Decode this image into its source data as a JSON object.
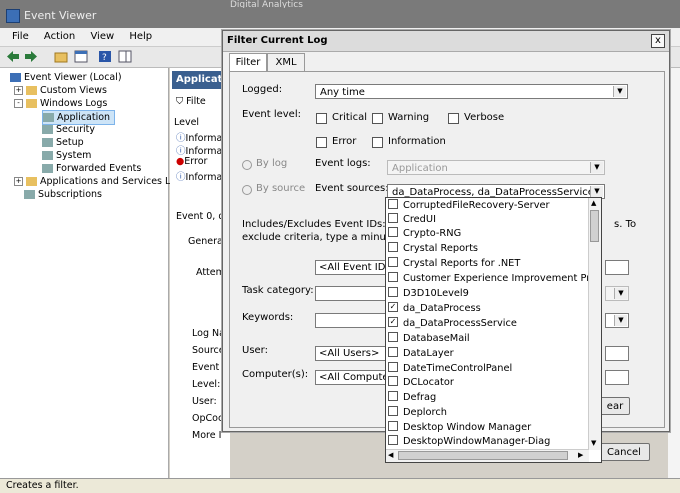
{
  "window": {
    "title": "Event Viewer",
    "other_window": "Digital Analytics",
    "menu": [
      "File",
      "Action",
      "View",
      "Help"
    ]
  },
  "tree": {
    "root": "Event Viewer (Local)",
    "custom_views": "Custom Views",
    "windows_logs": "Windows Logs",
    "logs": [
      "Application",
      "Security",
      "Setup",
      "System",
      "Forwarded Events"
    ],
    "apps_services": "Applications and Services Logs",
    "subscriptions": "Subscriptions"
  },
  "middle": {
    "header": "Application",
    "filter": "Filte",
    "level_header": "Level",
    "rows": [
      "Informa",
      "Informa",
      "Error",
      "Informa"
    ],
    "event_line": "Event 0, d",
    "general_tab": "General",
    "attempt": "Attem",
    "fields": [
      "Log Na",
      "Source",
      "Event I",
      "Level:",
      "User:",
      "OpCoc",
      "More I"
    ]
  },
  "status_text": "Creates a filter.",
  "dialog": {
    "title": "Filter Current Log",
    "close": "x",
    "tabs": [
      "Filter",
      "XML"
    ],
    "logged_label": "Logged:",
    "logged_value": "Any time",
    "event_level_label": "Event level:",
    "levels": [
      "Critical",
      "Warning",
      "Verbose",
      "Error",
      "Information"
    ],
    "by_log": "By log",
    "by_source": "By source",
    "event_logs_label": "Event logs:",
    "event_logs_value": "Application",
    "event_sources_label": "Event sources:",
    "event_sources_value": "da_DataProcess, da_DataProcessService",
    "includes_text_1": "Includes/Excludes Event IDs: Enter",
    "includes_text_2": "exclude criteria, type a minus sign",
    "includes_tail": "s. To",
    "event_ids_value": "<All Event IDs>",
    "task_category_label": "Task category:",
    "keywords_label": "Keywords:",
    "user_label": "User:",
    "user_value": "<All Users>",
    "computers_label": "Computer(s):",
    "computers_value": "<All Computers",
    "clear_button": "ear",
    "cancel_button": "Cancel"
  },
  "sources_list": [
    {
      "label": "CorruptedFileRecovery-Server",
      "checked": false
    },
    {
      "label": "CredUI",
      "checked": false
    },
    {
      "label": "Crypto-RNG",
      "checked": false
    },
    {
      "label": "Crystal Reports",
      "checked": false
    },
    {
      "label": "Crystal Reports for .NET",
      "checked": false
    },
    {
      "label": "Customer Experience Improvement Program",
      "checked": false
    },
    {
      "label": "D3D10Level9",
      "checked": false
    },
    {
      "label": "da_DataProcess",
      "checked": true
    },
    {
      "label": "da_DataProcessService",
      "checked": true
    },
    {
      "label": "DatabaseMail",
      "checked": false
    },
    {
      "label": "DataLayer",
      "checked": false
    },
    {
      "label": "DateTimeControlPanel",
      "checked": false
    },
    {
      "label": "DCLocator",
      "checked": false
    },
    {
      "label": "Defrag",
      "checked": false
    },
    {
      "label": "Deplorch",
      "checked": false
    },
    {
      "label": "Desktop Window Manager",
      "checked": false
    },
    {
      "label": "DesktopWindowManager-Diag",
      "checked": false
    }
  ]
}
